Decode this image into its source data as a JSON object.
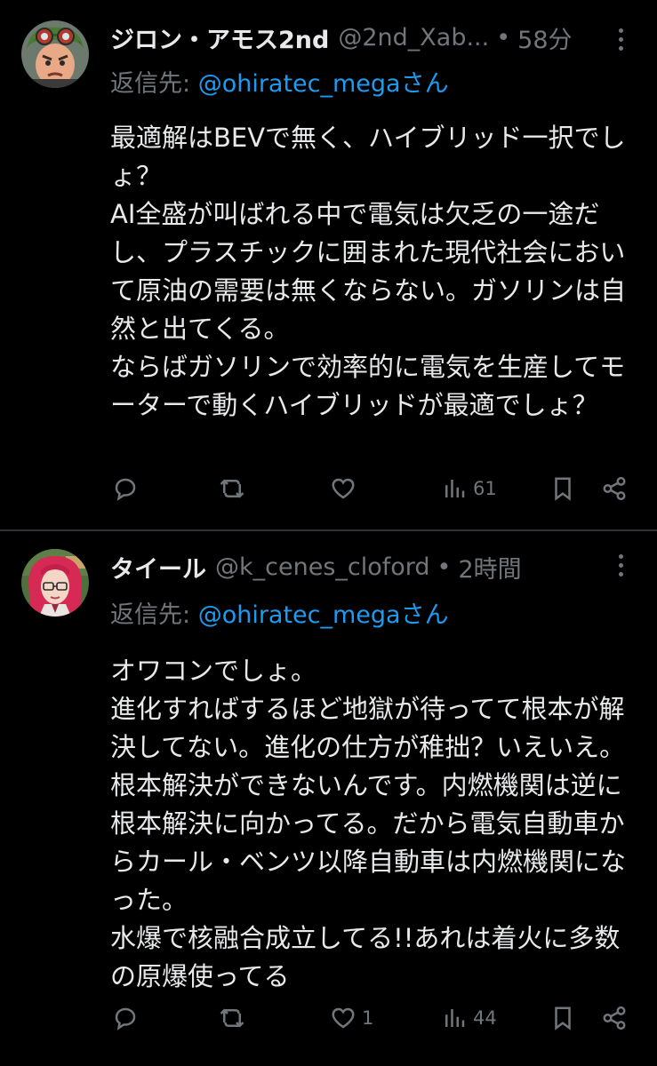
{
  "tweets": [
    {
      "name": "ジロン・アモス2nd",
      "handle": "@2nd_Xab...",
      "dot": "•",
      "time": "58分",
      "reply_prefix": "返信先: ",
      "reply_mention": "@ohiratec_megaさん",
      "text": "最適解はBEVで無く、ハイブリッド一択でしょ？\nAI全盛が叫ばれる中で電気は欠乏の一途だし、プラスチックに囲まれた現代社会において原油の需要は無くならない。ガソリンは自然と出てくる。\nならばガソリンで効率的に電気を生産してモーターで動くハイブリッドが最適でしょ？",
      "reply_count": "",
      "retweet_count": "",
      "like_count": "",
      "view_count": "61"
    },
    {
      "name": "タイール",
      "handle": "@k_cenes_cloford",
      "dot": "•",
      "time": "2時間",
      "reply_prefix": "返信先: ",
      "reply_mention": "@ohiratec_megaさん",
      "text": "オワコンでしょ。\n進化すればするほど地獄が待ってて根本が解決してない。進化の仕方が稚拙？いえいえ。根本解決ができないんです。内燃機関は逆に根本解決に向かってる。だから電気自動車からカール・ベンツ以降自動車は内燃機関になった。\n水爆で核融合成立してる!!あれは着火に多数の原爆使ってる",
      "reply_count": "",
      "retweet_count": "",
      "like_count": "1",
      "view_count": "44"
    }
  ],
  "icons": {
    "reply": "reply-icon",
    "retweet": "retweet-icon",
    "like": "heart-icon",
    "views": "views-icon",
    "bookmark": "bookmark-icon",
    "share": "share-icon",
    "more": "more-icon"
  },
  "colors": {
    "background": "#000000",
    "text": "#e7e9ea",
    "muted": "#71767b",
    "link": "#1d9bf0",
    "divider": "#2f3336"
  }
}
